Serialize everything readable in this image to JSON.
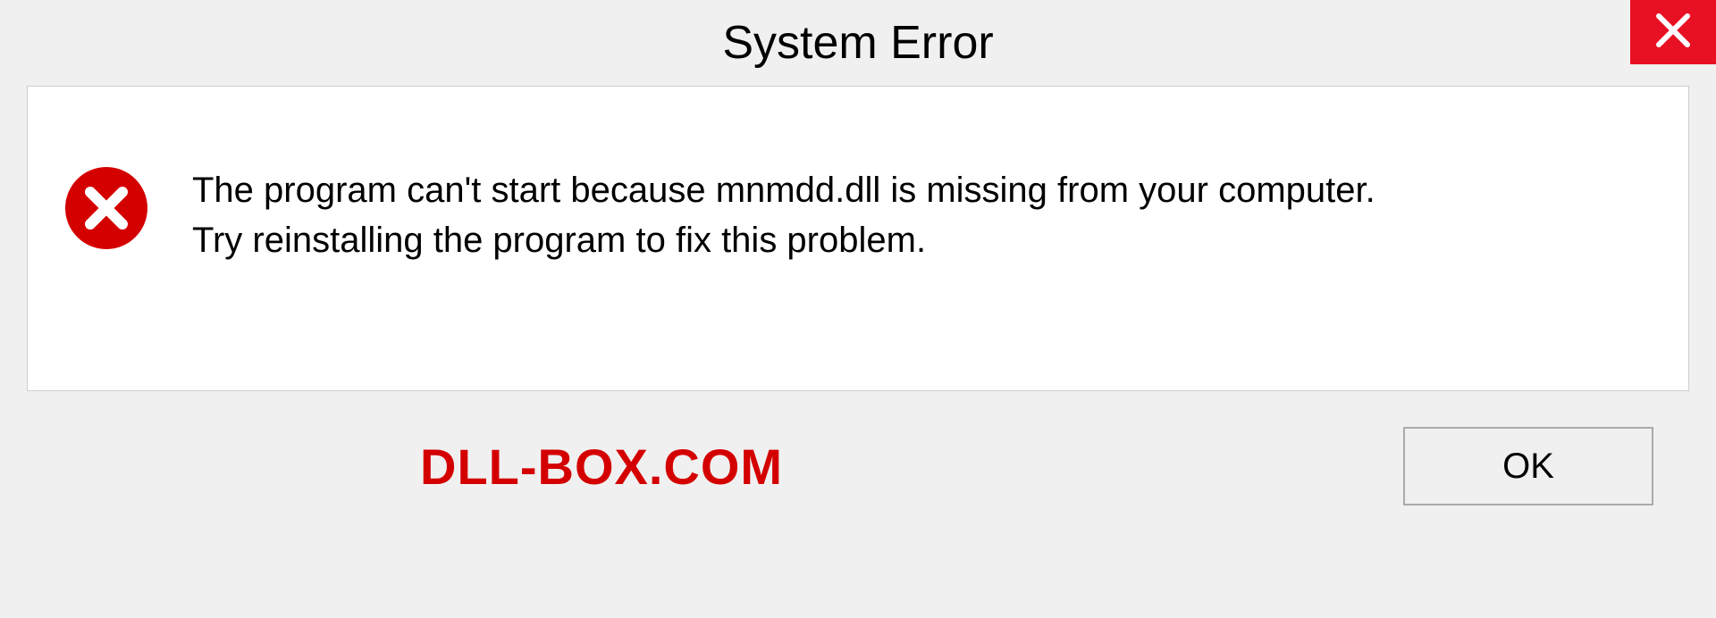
{
  "titlebar": {
    "title": "System Error"
  },
  "message": {
    "line1": "The program can't start because mnmdd.dll is missing from your computer.",
    "line2": "Try reinstalling the program to fix this problem."
  },
  "footer": {
    "brand": "DLL-BOX.COM",
    "ok_label": "OK"
  }
}
